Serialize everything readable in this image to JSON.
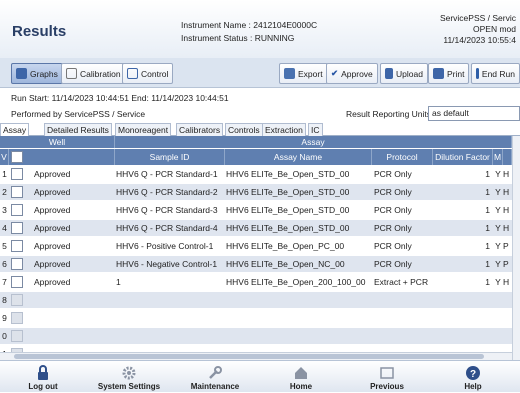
{
  "header": {
    "title": "Results",
    "instrument_name": "Instrument Name : 2412104E0000C",
    "instrument_status": "Instrument Status : RUNNING",
    "user": "ServicePSS / Servic",
    "mode": "OPEN mod",
    "datetime": "11/14/2023 10:55:4"
  },
  "toolbar": {
    "graphs": "Graphs",
    "calibration": "Calibration",
    "control": "Control",
    "export": "Export",
    "approve": "Approve",
    "upload": "Upload",
    "print": "Print",
    "end_run": "End Run"
  },
  "run": {
    "run_start": "Run  Start: 11/14/2023 10:44:51   End: 11/14/2023 10:44:51",
    "performed_by": "Performed by ServicePSS / Service",
    "units_label": "Result Reporting Units",
    "units_value": "as default"
  },
  "tabs": [
    "Assay",
    "Detailed Results",
    "Monoreagent",
    "Calibrators",
    "Controls",
    "Extraction",
    "IC"
  ],
  "grid": {
    "group_headers": {
      "well": "Well",
      "assay": "Assay"
    },
    "columns": {
      "status_col": "V",
      "sample_id": "Sample ID",
      "assay_name": "Assay Name",
      "protocol": "Protocol",
      "dilution": "Dilution Factor",
      "m": "M"
    },
    "rows": [
      {
        "n": "1",
        "status": "Approved",
        "sample": "HHV6 Q - PCR Standard-1",
        "assay": "HHV6 ELITe_Be_Open_STD_00",
        "protocol": "PCR Only",
        "dil": "1",
        "m": "Y",
        "x": "H"
      },
      {
        "n": "2",
        "status": "Approved",
        "sample": "HHV6 Q - PCR Standard-2",
        "assay": "HHV6 ELITe_Be_Open_STD_00",
        "protocol": "PCR Only",
        "dil": "1",
        "m": "Y",
        "x": "H"
      },
      {
        "n": "3",
        "status": "Approved",
        "sample": "HHV6 Q - PCR Standard-3",
        "assay": "HHV6 ELITe_Be_Open_STD_00",
        "protocol": "PCR Only",
        "dil": "1",
        "m": "Y",
        "x": "H"
      },
      {
        "n": "4",
        "status": "Approved",
        "sample": "HHV6 Q - PCR Standard-4",
        "assay": "HHV6 ELITe_Be_Open_STD_00",
        "protocol": "PCR Only",
        "dil": "1",
        "m": "Y",
        "x": "H"
      },
      {
        "n": "5",
        "status": "Approved",
        "sample": "HHV6 - Positive Control-1",
        "assay": "HHV6 ELITe_Be_Open_PC_00",
        "protocol": "PCR Only",
        "dil": "1",
        "m": "Y",
        "x": "P"
      },
      {
        "n": "6",
        "status": "Approved",
        "sample": "HHV6 - Negative Control-1",
        "assay": "HHV6 ELITe_Be_Open_NC_00",
        "protocol": "PCR Only",
        "dil": "1",
        "m": "Y",
        "x": "P"
      },
      {
        "n": "7",
        "status": "Approved",
        "sample": "1",
        "assay": "HHV6 ELITe_Be_Open_200_100_00",
        "protocol": "Extract + PCR",
        "dil": "1",
        "m": "Y",
        "x": "H"
      },
      {
        "n": "8",
        "status": "",
        "sample": "",
        "assay": "",
        "protocol": "",
        "dil": "",
        "m": "",
        "x": ""
      },
      {
        "n": "9",
        "status": "",
        "sample": "",
        "assay": "",
        "protocol": "",
        "dil": "",
        "m": "",
        "x": ""
      },
      {
        "n": "0",
        "status": "",
        "sample": "",
        "assay": "",
        "protocol": "",
        "dil": "",
        "m": "",
        "x": ""
      },
      {
        "n": "1",
        "status": "",
        "sample": "",
        "assay": "",
        "protocol": "",
        "dil": "",
        "m": "",
        "x": ""
      }
    ]
  },
  "nav": {
    "logout": "Log out",
    "system_settings": "System Settings",
    "maintenance": "Maintenance",
    "home": "Home",
    "previous": "Previous",
    "help": "Help"
  },
  "colors": {
    "header_blue": "#5f7fb0",
    "row_alt": "#dfe5ef",
    "title": "#2a3f66"
  }
}
